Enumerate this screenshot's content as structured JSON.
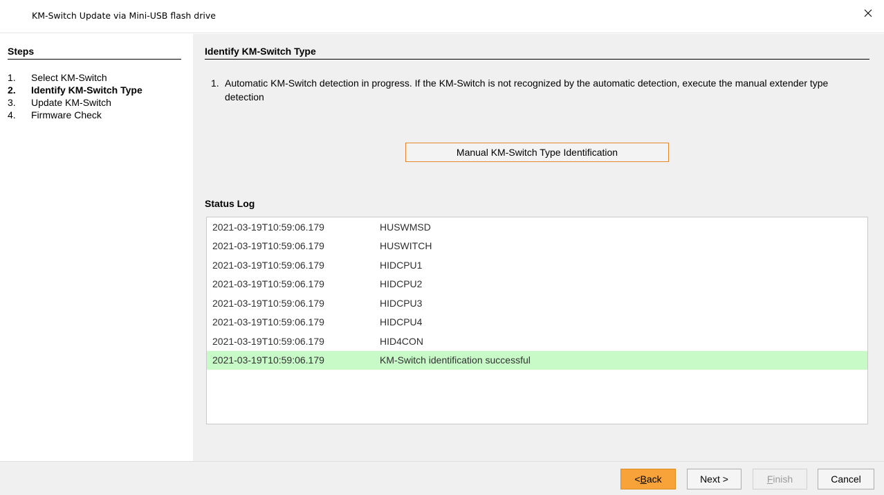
{
  "window": {
    "title": "KM-Switch Update via Mini-USB flash drive",
    "close_icon": "close-icon"
  },
  "sidebar": {
    "heading": "Steps",
    "steps": [
      {
        "num": "1.",
        "label": "Select KM-Switch",
        "active": false
      },
      {
        "num": "2.",
        "label": "Identify KM-Switch Type",
        "active": true
      },
      {
        "num": "3.",
        "label": "Update KM-Switch",
        "active": false
      },
      {
        "num": "4.",
        "label": "Firmware Check",
        "active": false
      }
    ]
  },
  "main": {
    "heading": "Identify KM-Switch Type",
    "instruction": {
      "num": "1.",
      "text": "Automatic KM-Switch detection in progress. If the KM-Switch is not recognized by the automatic detection, execute the manual extender type detection"
    },
    "manual_button": "Manual KM-Switch Type Identification",
    "status_title": "Status Log",
    "log": [
      {
        "time": "2021-03-19T10:59:06.179",
        "message": "HUSWMSD"
      },
      {
        "time": "2021-03-19T10:59:06.179",
        "message": "HUSWITCH"
      },
      {
        "time": "2021-03-19T10:59:06.179",
        "message": "HIDCPU1"
      },
      {
        "time": "2021-03-19T10:59:06.179",
        "message": "HIDCPU2"
      },
      {
        "time": "2021-03-19T10:59:06.179",
        "message": "HIDCPU3"
      },
      {
        "time": "2021-03-19T10:59:06.179",
        "message": "HIDCPU4"
      },
      {
        "time": "2021-03-19T10:59:06.179",
        "message": "HID4CON"
      },
      {
        "time": "2021-03-19T10:59:06.179",
        "message": "KM-Switch identification successful"
      }
    ],
    "success_color": "#c8fac8"
  },
  "footer": {
    "back": {
      "prefix": "< ",
      "mnemonic": "B",
      "rest": "ack"
    },
    "next": "Next >",
    "finish": {
      "mnemonic": "F",
      "rest": "inish"
    },
    "cancel": "Cancel",
    "accent_color": "#f8a33a"
  }
}
